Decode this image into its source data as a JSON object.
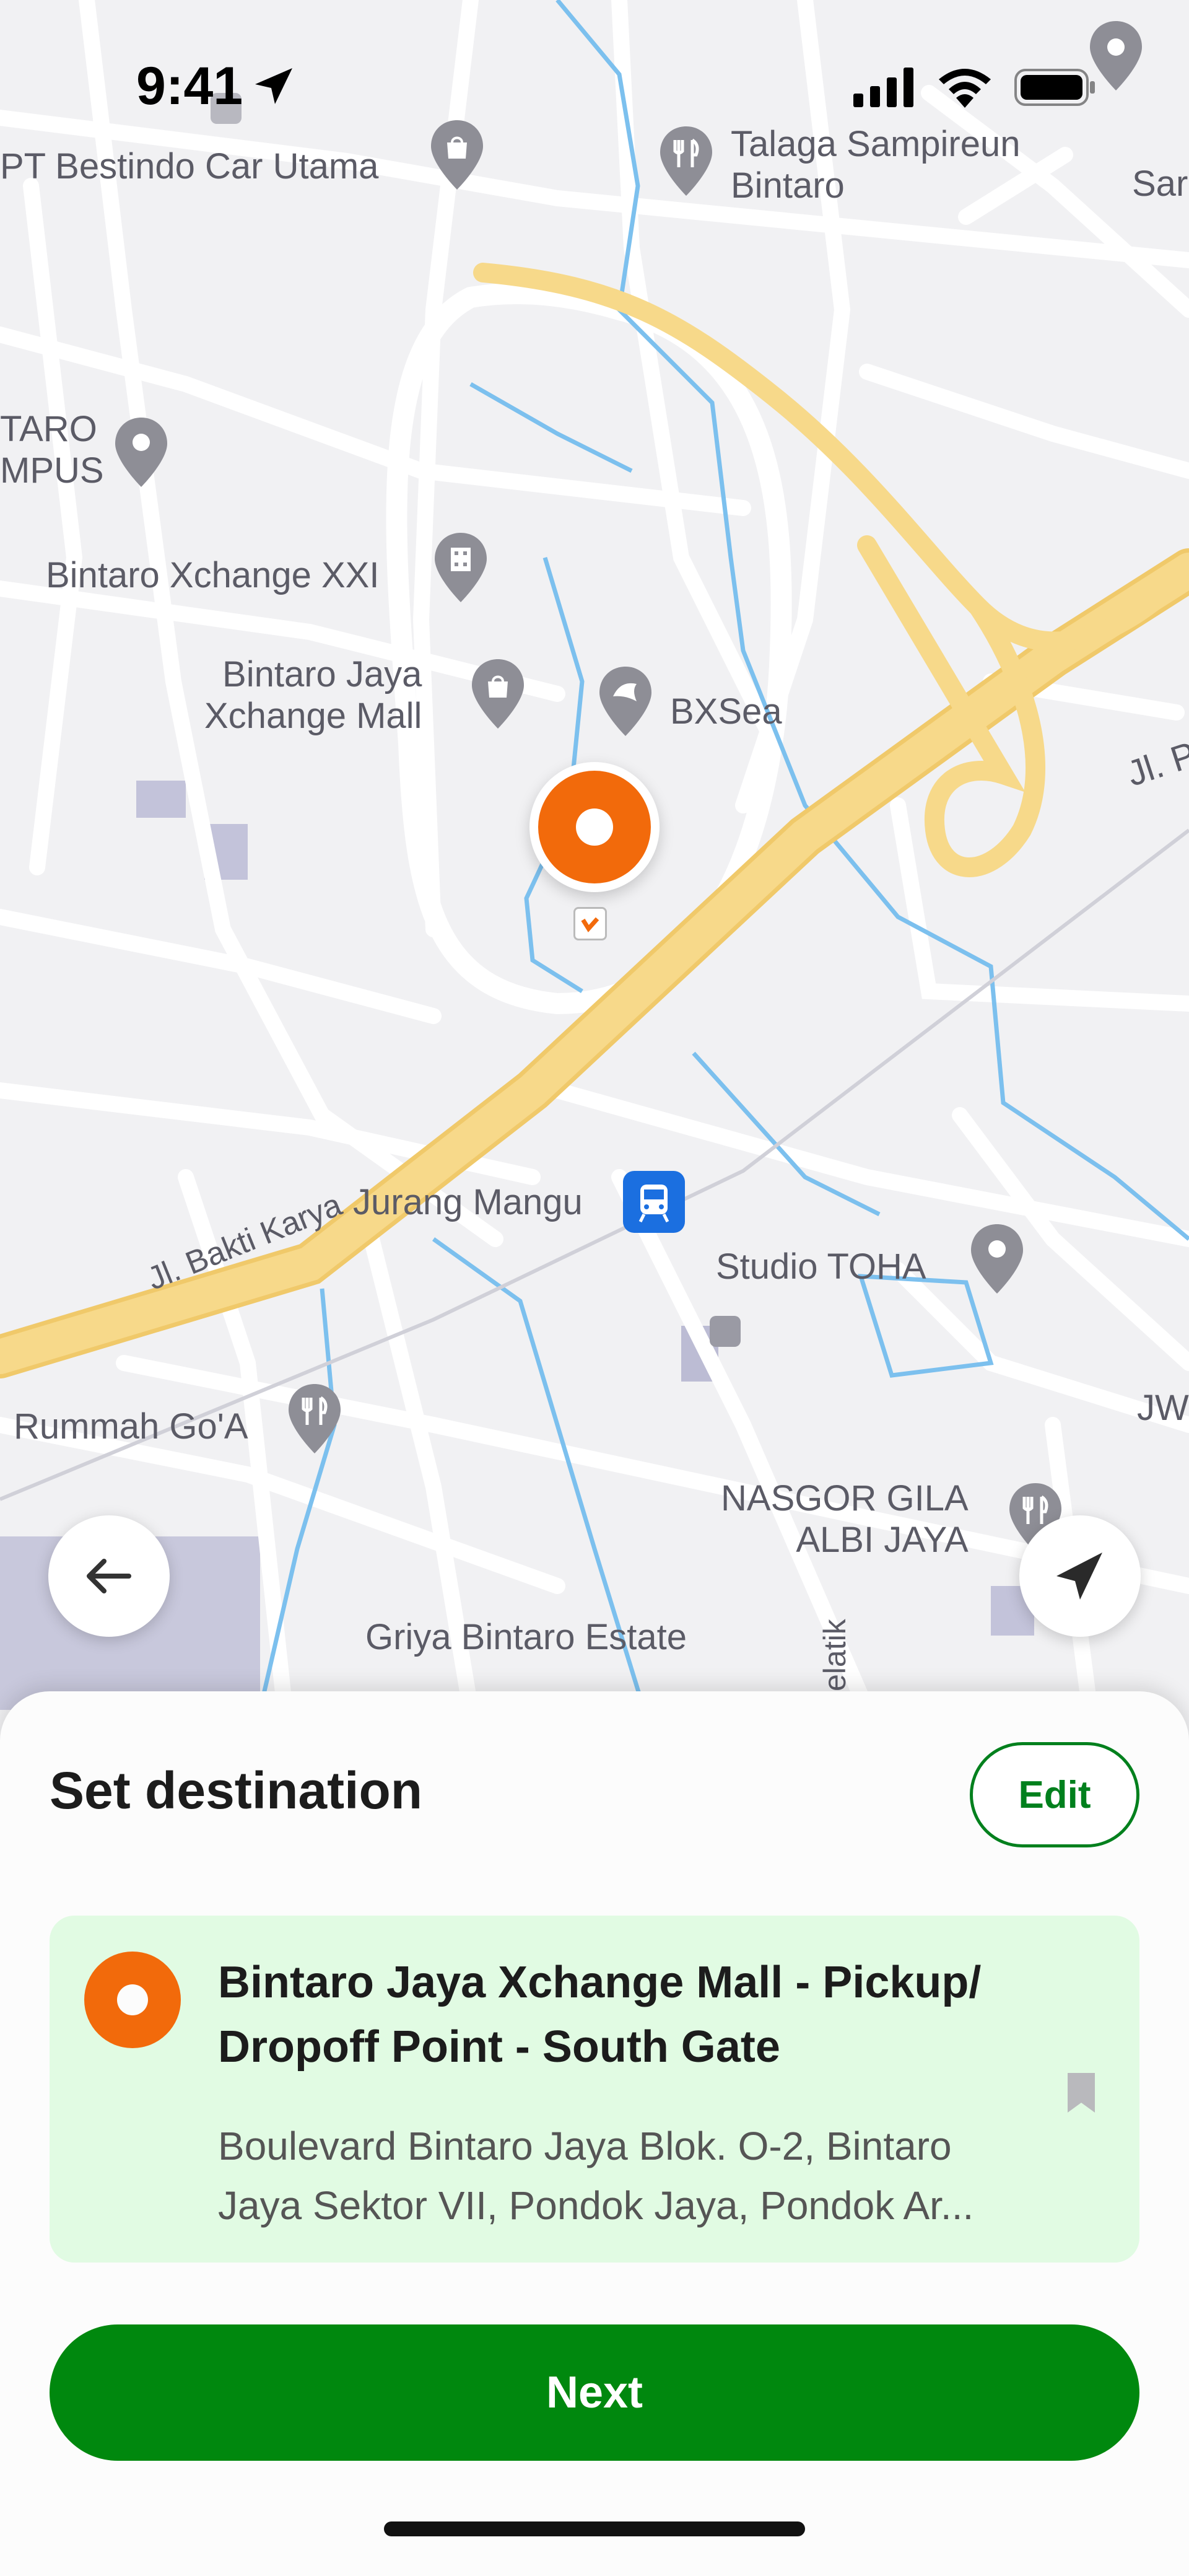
{
  "status_bar": {
    "time": "9:41"
  },
  "map": {
    "labels": {
      "car_dealer": "PT Bestindo Car Utama",
      "restaurant_talaga": "Talaga Sampireun\nBintaro",
      "right_edge_top": "Sar",
      "campus": "TARO\nMPUS",
      "cinema": "Bintaro Xchange XXI",
      "mall": "Bintaro Jaya\nXchange Mall",
      "aquarium": "BXSea",
      "road_right": "Jl. Pa",
      "road_bakti": "Jl. Bakti Karya",
      "station": "Jurang Mangu",
      "studio": "Studio TOHA",
      "restaurant_rummah": "Rummah Go'A",
      "right_edge_mid": "JW",
      "nasgor": "NASGOR GILA\nALBI JAYA",
      "estate": "Griya Bintaro Estate",
      "road_vertical": "elatik"
    }
  },
  "sheet": {
    "title": "Set destination",
    "edit_label": "Edit",
    "destination": {
      "title": "Bintaro Jaya Xchange Mall - Pickup/ Dropoff Point - South Gate",
      "address": "Boulevard Bintaro Jaya Blok. O-2, Bintaro Jaya Sektor VII, Pondok Jaya, Pondok Ar..."
    },
    "next_label": "Next"
  },
  "colors": {
    "accent_green": "#00880e",
    "pin_orange": "#f26a0b",
    "card_bg": "#e1fbe3",
    "highway": "#f7d98a",
    "water": "#7cc0ee"
  },
  "icons": {
    "back": "arrow-left-icon",
    "locate": "navigation-arrow-icon",
    "bookmark": "bookmark-icon"
  }
}
